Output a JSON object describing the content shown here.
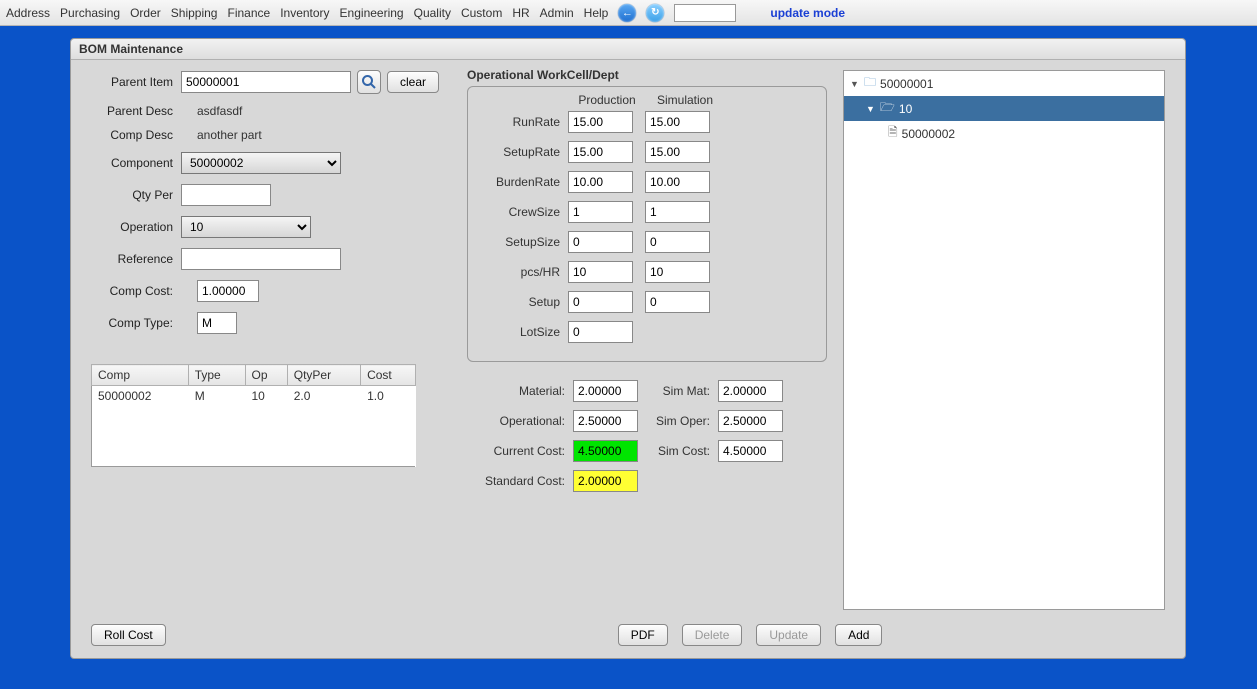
{
  "menu": {
    "items": [
      "Address",
      "Purchasing",
      "Order",
      "Shipping",
      "Finance",
      "Inventory",
      "Engineering",
      "Quality",
      "Custom",
      "HR",
      "Admin",
      "Help"
    ],
    "mode_label": "update mode",
    "search_value": ""
  },
  "panel": {
    "title": "BOM Maintenance"
  },
  "left": {
    "parent_item_label": "Parent Item",
    "parent_item_value": "50000001",
    "clear_label": "clear",
    "parent_desc_label": "Parent Desc",
    "parent_desc_value": "asdfasdf",
    "comp_desc_label": "Comp Desc",
    "comp_desc_value": "another part",
    "component_label": "Component",
    "component_value": "50000002",
    "qty_per_label": "Qty Per",
    "qty_per_value": "",
    "operation_label": "Operation",
    "operation_value": "10",
    "reference_label": "Reference",
    "reference_value": "",
    "comp_cost_label": "Comp Cost:",
    "comp_cost_value": "1.00000",
    "comp_type_label": "Comp Type:",
    "comp_type_value": "M"
  },
  "table": {
    "headers": [
      "Comp",
      "Type",
      "Op",
      "QtyPer",
      "Cost"
    ],
    "rows": [
      {
        "comp": "50000002",
        "type": "M",
        "op": "10",
        "qtyper": "2.0",
        "cost": "1.0"
      }
    ]
  },
  "workcell": {
    "title": "Operational WorkCell/Dept",
    "col_prod": "Production",
    "col_sim": "Simulation",
    "rows": [
      {
        "label": "RunRate",
        "prod": "15.00",
        "sim": "15.00"
      },
      {
        "label": "SetupRate",
        "prod": "15.00",
        "sim": "15.00"
      },
      {
        "label": "BurdenRate",
        "prod": "10.00",
        "sim": "10.00"
      },
      {
        "label": "CrewSize",
        "prod": "1",
        "sim": "1"
      },
      {
        "label": "SetupSize",
        "prod": "0",
        "sim": "0"
      },
      {
        "label": "pcs/HR",
        "prod": "10",
        "sim": "10"
      },
      {
        "label": "Setup",
        "prod": "0",
        "sim": "0"
      }
    ],
    "lot_label": "LotSize",
    "lot_value": "0"
  },
  "costs": {
    "material_label": "Material:",
    "material_value": "2.00000",
    "simmat_label": "Sim Mat:",
    "simmat_value": "2.00000",
    "operational_label": "Operational:",
    "operational_value": "2.50000",
    "simoper_label": "Sim Oper:",
    "simoper_value": "2.50000",
    "current_label": "Current Cost:",
    "current_value": "4.50000",
    "simcost_label": "Sim Cost:",
    "simcost_value": "4.50000",
    "standard_label": "Standard Cost:",
    "standard_value": "2.00000"
  },
  "tree": {
    "root": "50000001",
    "child": "10",
    "leaf": "50000002"
  },
  "buttons": {
    "roll": "Roll Cost",
    "pdf": "PDF",
    "delete": "Delete",
    "update": "Update",
    "add": "Add"
  }
}
